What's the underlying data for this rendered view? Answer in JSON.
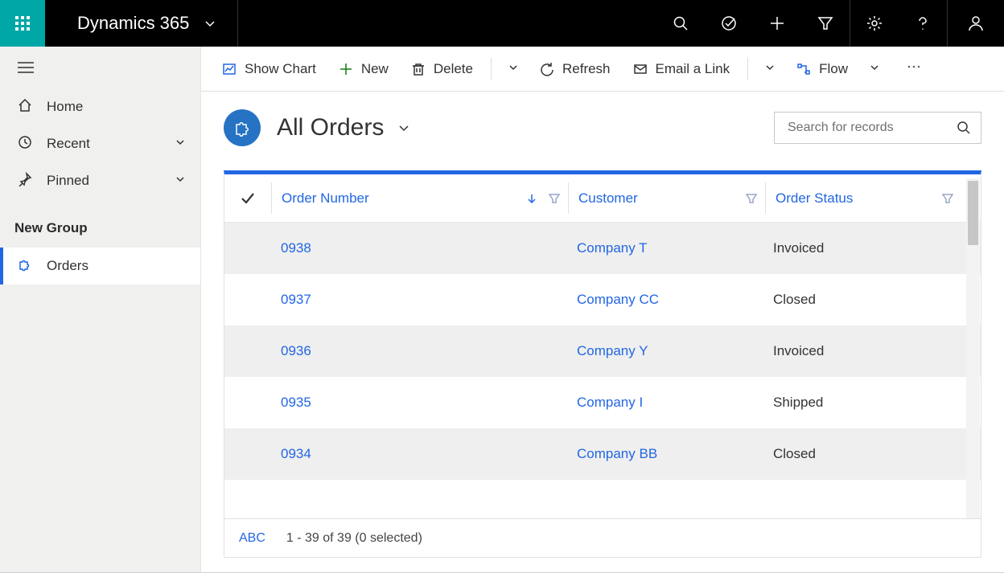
{
  "brand": "Dynamics 365",
  "nav": {
    "home": "Home",
    "recent": "Recent",
    "pinned": "Pinned",
    "section_title": "New Group",
    "orders": "Orders"
  },
  "cmdbar": {
    "show_chart": "Show Chart",
    "new": "New",
    "delete": "Delete",
    "refresh": "Refresh",
    "email_link": "Email a Link",
    "flow": "Flow"
  },
  "view": {
    "title": "All Orders",
    "search_placeholder": "Search for records"
  },
  "grid": {
    "headers": {
      "order_number": "Order Number",
      "customer": "Customer",
      "order_status": "Order Status"
    },
    "rows": [
      {
        "order": "0938",
        "customer": "Company T",
        "status": "Invoiced"
      },
      {
        "order": "0937",
        "customer": "Company CC",
        "status": "Closed"
      },
      {
        "order": "0936",
        "customer": "Company Y",
        "status": "Invoiced"
      },
      {
        "order": "0935",
        "customer": "Company I",
        "status": "Shipped"
      },
      {
        "order": "0934",
        "customer": "Company BB",
        "status": "Closed"
      }
    ],
    "footer": {
      "abc": "ABC",
      "count": "1 - 39 of 39 (0 selected)"
    }
  }
}
